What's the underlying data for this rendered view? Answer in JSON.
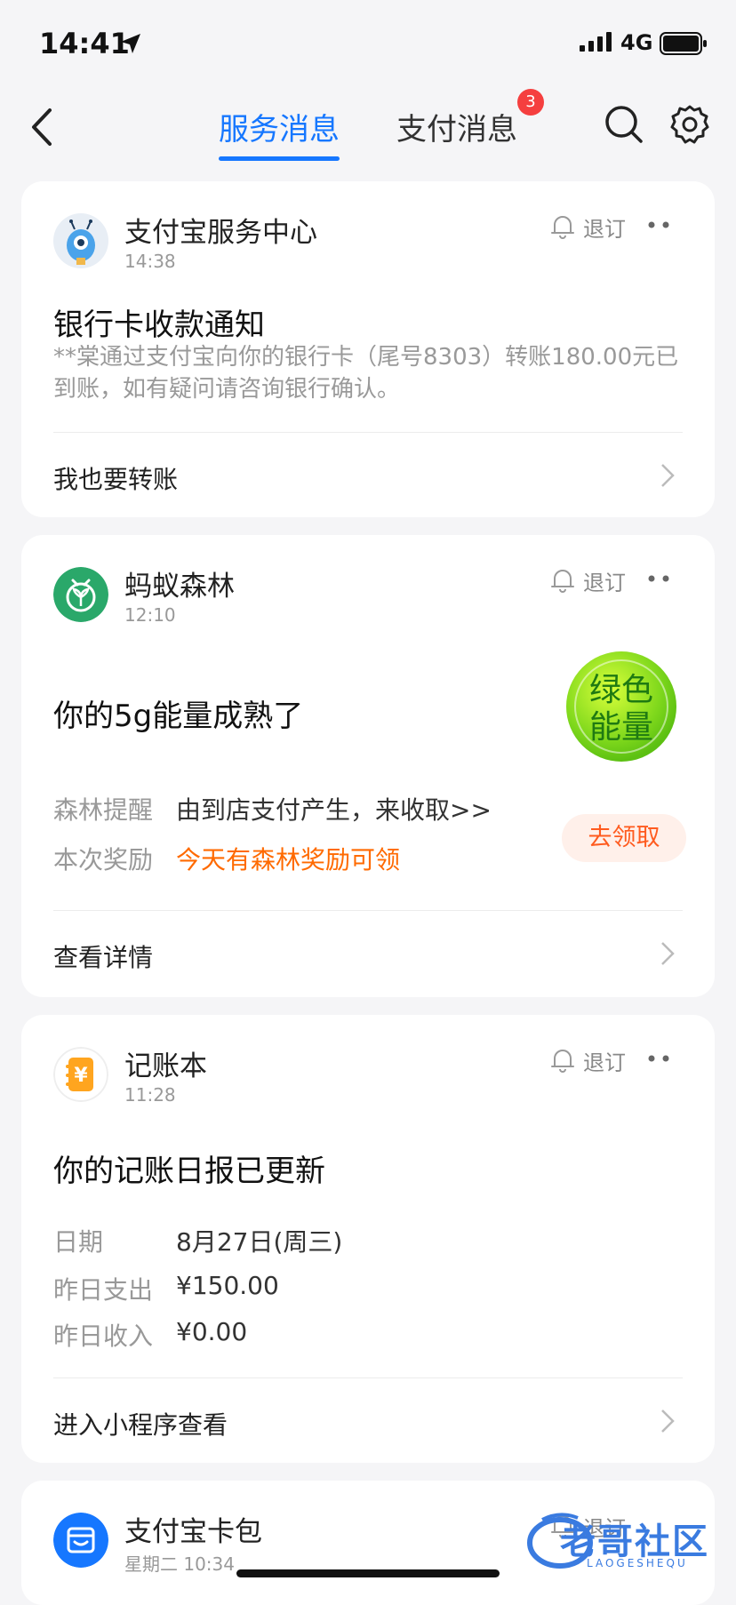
{
  "status_bar": {
    "time": "14:41",
    "network": "4G"
  },
  "header": {
    "tabs": [
      {
        "label": "服务消息",
        "active": true
      },
      {
        "label": "支付消息",
        "active": false,
        "badge": "3"
      }
    ],
    "accent_color": "#1677ff"
  },
  "cards": [
    {
      "name": "支付宝服务中心",
      "time": "14:38",
      "unsubscribe": "退订",
      "title": "银行卡收款通知",
      "body": "**棠通过支付宝向你的银行卡（尾号8303）转账180.00元已到账，如有疑问请咨询银行确认。",
      "footer": "我也要转账"
    },
    {
      "name": "蚂蚁森林",
      "time": "12:10",
      "unsubscribe": "退订",
      "title": "你的5g能量成熟了",
      "energy_ball_text": [
        "绿色",
        "能量"
      ],
      "rows": [
        {
          "label": "森林提醒",
          "value": "由到店支付产生，来收取>>"
        },
        {
          "label": "本次奖励",
          "value": "今天有森林奖励可领"
        }
      ],
      "action": "去领取",
      "footer": "查看详情"
    },
    {
      "name": "记账本",
      "time": "11:28",
      "unsubscribe": "退订",
      "title": "你的记账日报已更新",
      "icon_glyph": "¥",
      "rows": [
        {
          "label": "日期",
          "value": "8月27日(周三)"
        },
        {
          "label": "昨日支出",
          "value": "¥150.00"
        },
        {
          "label": "昨日收入",
          "value": "¥0.00"
        }
      ],
      "footer": "进入小程序查看"
    },
    {
      "name": "支付宝卡包",
      "time": "星期二 10:34",
      "unsubscribe": "退订"
    }
  ],
  "watermark": {
    "text": "老哥社区",
    "sub": "LAOGESHEQU"
  }
}
